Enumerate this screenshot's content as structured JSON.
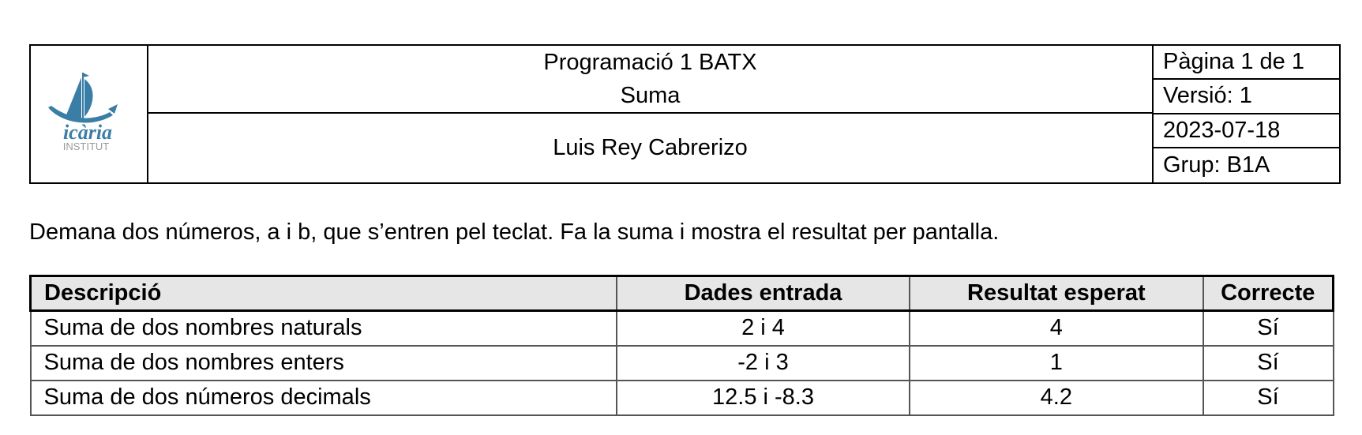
{
  "header": {
    "logo_text": "icària",
    "logo_subtext": "INSTITUT",
    "course": "Programació 1 BATX",
    "exercise": "Suma",
    "author": "Luis Rey Cabrerizo",
    "page": "Pàgina 1 de 1",
    "version": "Versió: 1",
    "date": "2023-07-18",
    "group": "Grup: B1A"
  },
  "colors": {
    "logo_blue": "#3a7ea6",
    "header_bg": "#e6e6e6"
  },
  "description": "Demana dos números, a i b, que s’entren pel teclat. Fa la suma i mostra el resultat per pantalla.",
  "table": {
    "columns": [
      "Descripció",
      "Dades entrada",
      "Resultat esperat",
      "Correcte"
    ],
    "rows": [
      [
        "Suma de dos nombres naturals",
        "2 i 4",
        "4",
        "Sí"
      ],
      [
        "Suma de dos nombres enters",
        "-2 i 3",
        "1",
        "Sí"
      ],
      [
        "Suma de dos números decimals",
        "12.5 i -8.3",
        "4.2",
        "Sí"
      ]
    ]
  }
}
